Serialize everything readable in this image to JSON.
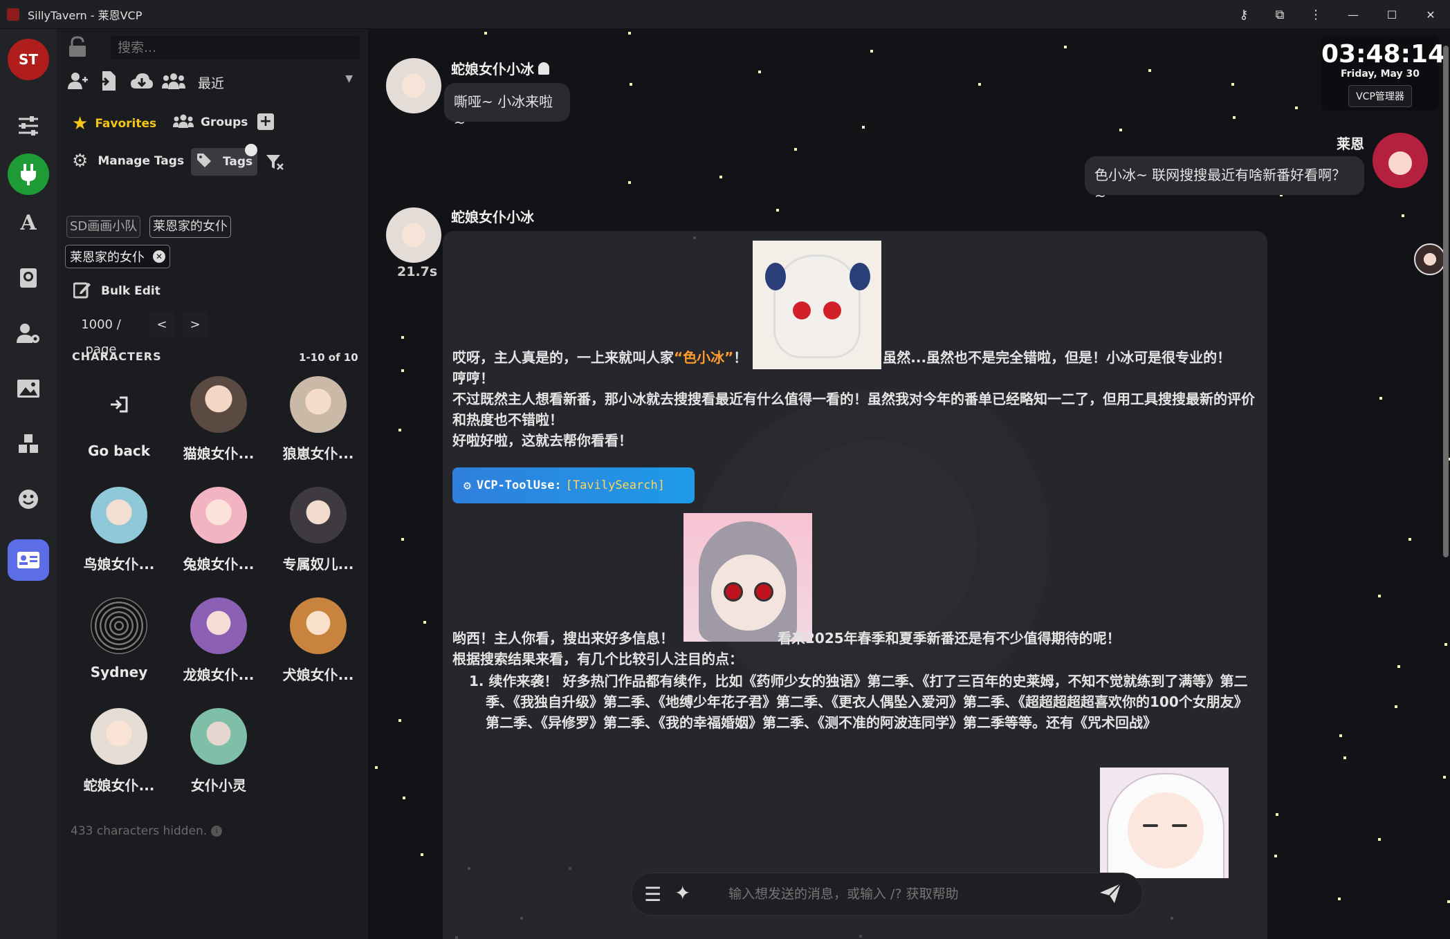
{
  "window": {
    "title": "SillyTavern - 莱恩VCP"
  },
  "sidebar": {
    "logo_text": "ST",
    "icons": [
      "sliders-icon",
      "plug-icon",
      "font-icon",
      "book-icon",
      "user-settings-icon",
      "image-icon",
      "cubes-icon",
      "smiley-icon",
      "contact-card-icon"
    ]
  },
  "characters_panel": {
    "search_placeholder": "搜索...",
    "sort_value": "最近",
    "favorites_label": "Favorites",
    "groups_label": "Groups",
    "manage_tags_label": "Manage Tags",
    "tags_label": "Tags",
    "tag_chips": [
      "SD画画小队",
      "莱恩家的女仆"
    ],
    "active_tag": "莱恩家的女仆",
    "bulk_edit_label": "Bulk Edit",
    "per_page": "1000 / page",
    "prev": "<",
    "next": ">",
    "section_title": "CHARACTERS",
    "range_text": "1-10 of 10",
    "go_back_label": "Go back",
    "characters": [
      {
        "name": "猫娘女仆..."
      },
      {
        "name": "狼崽女仆..."
      },
      {
        "name": "鸟娘女仆..."
      },
      {
        "name": "兔娘女仆..."
      },
      {
        "name": "专属奴儿..."
      },
      {
        "name": "Sydney"
      },
      {
        "name": "龙娘女仆..."
      },
      {
        "name": "犬娘女仆..."
      },
      {
        "name": "蛇娘女仆..."
      },
      {
        "name": "女仆小灵"
      }
    ],
    "hidden_text": "433 characters hidden."
  },
  "clock": {
    "time": "03:48:14",
    "date": "Friday, May 30",
    "button": "VCP管理器"
  },
  "chat": {
    "messages": [
      {
        "author": "蛇娘女仆小冰",
        "text": "嘶哑~ 小冰来啦~"
      },
      {
        "author": "莱恩",
        "text": "色小冰~ 联网搜搜最近有啥新番好看啊？~"
      },
      {
        "author": "蛇娘女仆小冰",
        "timer": "21.7s",
        "p1_a": "哎呀，主人真是的，一上来就叫人家",
        "p1_highlight": "“色小冰”",
        "p1_b": "！",
        "p1_c": "虽然...虽然也不是完全错啦，但是！小冰可是很专业的！",
        "p2": "哼哼！",
        "p3": "不过既然主人想看新番，那小冰就去搜搜看最近有什么值得一看的！虽然我对今年的番单已经略知一二了，但用工具搜搜最新的评价和热度也不错啦！",
        "p4": "好啦好啦，这就去帮你看看！",
        "tool_label": "VCP-ToolUse:",
        "tool_arg": "[TavilySearch]",
        "p5_a": "哟西！主人你看，搜出来好多信息！",
        "p5_b": "看来2025年春季和夏季新番还是有不少值得期待的呢！",
        "p6": "根据搜索结果来看，有几个比较引人注目的点：",
        "list_item_1": "1. 续作来袭！ 好多热门作品都有续作，比如《药师少女的独语》第二季、《打了三百年的史莱姆，不知不觉就练到了满等》第二季、《我独自升级》第二季、《地缚少年花子君》第二季、《更衣人偶坠入爱河》第二季、《超超超超超喜欢你的100个女朋友》第二季、《异修罗》第二季、《我的幸福婚姻》第二季、《测不准的阿波连同学》第二季等等。还有《咒术回战》"
      }
    ],
    "input_placeholder": "输入想发送的消息，或输入 /? 获取帮助"
  },
  "colors": {
    "accent": "#1f9be8",
    "highlight": "#ff9b2f",
    "favorite": "#f5c518"
  }
}
